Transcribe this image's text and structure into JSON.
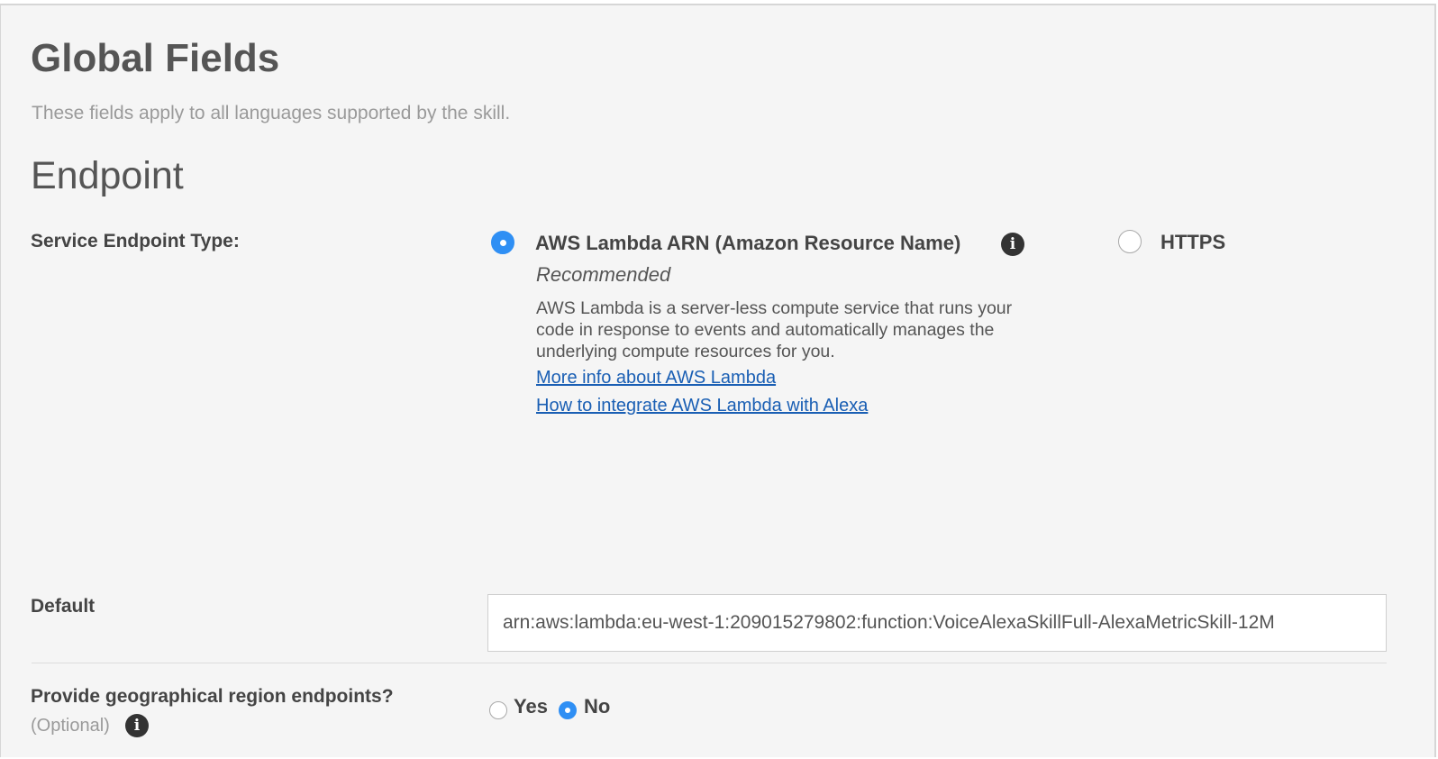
{
  "header": {
    "title": "Global Fields",
    "subtitle": "These fields apply to all languages supported by the skill."
  },
  "endpoint": {
    "heading": "Endpoint",
    "type_label": "Service Endpoint Type:",
    "options": [
      {
        "label": "AWS Lambda ARN (Amazon Resource Name)",
        "selected": true,
        "recommended": "Recommended",
        "description": "AWS Lambda is a server-less compute service that runs your code in response to events and automatically manages the underlying compute resources for you.",
        "links": [
          "More info about AWS Lambda",
          "How to integrate AWS Lambda with Alexa"
        ]
      },
      {
        "label": "HTTPS",
        "selected": false
      }
    ],
    "default_label": "Default",
    "default_value": "arn:aws:lambda:eu-west-1:209015279802:function:VoiceAlexaSkillFull-AlexaMetricSkill-12M"
  },
  "geo": {
    "question": "Provide geographical region endpoints?",
    "optional": "(Optional)",
    "yes_label": "Yes",
    "no_label": "No",
    "selected": "No"
  },
  "colors": {
    "accent": "#2f8ff4",
    "link": "#1a5fb4",
    "panel_bg": "#f5f5f5"
  }
}
